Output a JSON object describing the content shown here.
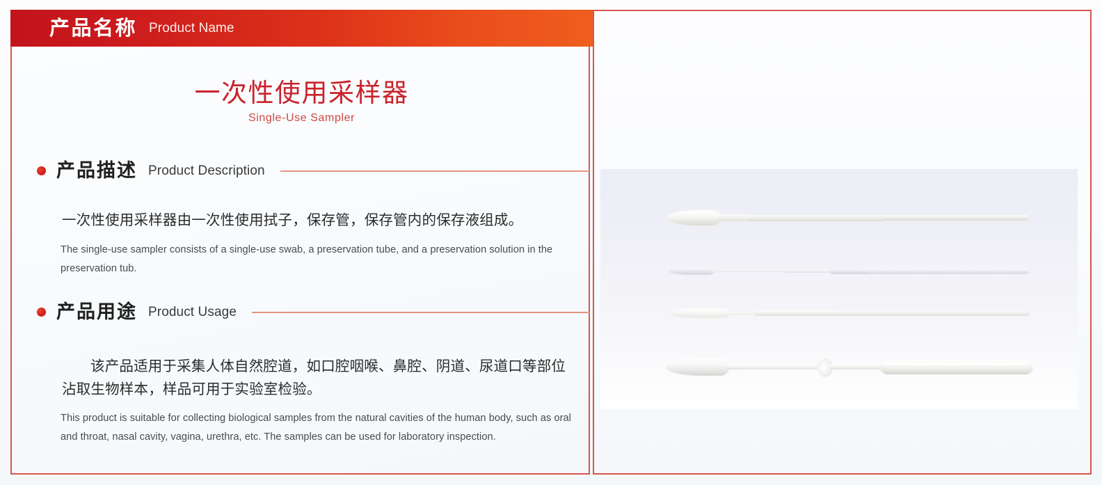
{
  "header": {
    "title_cn": "产品名称",
    "title_en": "Product Name"
  },
  "product": {
    "name_cn": "一次性使用采样器",
    "name_en": "Single-Use Sampler"
  },
  "sections": [
    {
      "id": "description",
      "heading_cn": "产品描述",
      "heading_en": "Product Description",
      "body_cn": "一次性使用采样器由一次性使用拭子，保存管，保存管内的保存液组成。",
      "body_en": "The single-use sampler consists of a single-use swab, a preservation tube, and a preservation solution in the preservation tub."
    },
    {
      "id": "usage",
      "heading_cn": "产品用途",
      "heading_en": "Product Usage",
      "body_cn": "该产品适用于采集人体自然腔道，如口腔咽喉、鼻腔、阴道、尿道口等部位沾取生物样本，样品可用于实验室检验。",
      "body_en": "This product is suitable for collecting biological samples from the natural cavities of the human body, such as oral and throat, nasal cavity, vagina, urethra, etc. The samples can be used for laboratory inspection."
    }
  ],
  "gallery": {
    "items": [
      {
        "name": "flocked-swab-large-tip"
      },
      {
        "name": "thin-shaft-swab"
      },
      {
        "name": "nasopharyngeal-swab"
      },
      {
        "name": "breakpoint-swab-with-collar"
      }
    ]
  },
  "colors": {
    "brand_red": "#c2141c",
    "brand_orange": "#ef5e1f",
    "border_red": "#d8554e",
    "rule_salmon": "#e59480",
    "title_red": "#c9232b",
    "photo_bg": "#ecedf5"
  }
}
